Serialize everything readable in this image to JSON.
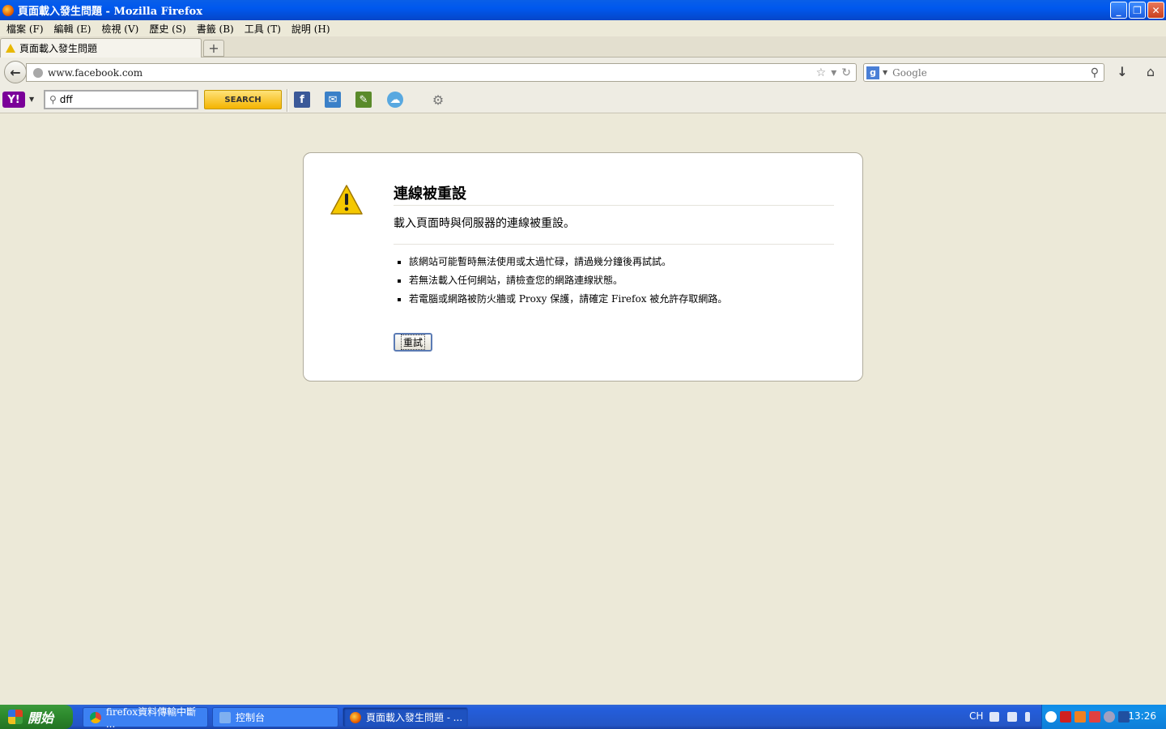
{
  "window": {
    "title": "頁面載入發生問題 - Mozilla Firefox",
    "controls": {
      "minimize": "_",
      "restore": "❐",
      "close": "✕"
    }
  },
  "menu": [
    "檔案 (F)",
    "編輯 (E)",
    "檢視 (V)",
    "歷史 (S)",
    "書籤 (B)",
    "工具 (T)",
    "說明 (H)"
  ],
  "tabs": [
    {
      "label": "頁面載入發生問題",
      "icon": "warning-icon"
    }
  ],
  "new_tab_label": "+",
  "nav": {
    "url": "www.facebook.com",
    "search_placeholder": "Google"
  },
  "yahoo_toolbar": {
    "logo": "Y!",
    "search_value": "dff",
    "search_button": "SEARCH",
    "icons": [
      "facebook-icon",
      "mail-icon",
      "notes-icon",
      "weather-icon",
      "gear-icon"
    ]
  },
  "error": {
    "title": "連線被重設",
    "description": "載入頁面時與伺服器的連線被重設。",
    "items": [
      "該網站可能暫時無法使用或太過忙碌，請過幾分鐘後再試試。",
      "若無法載入任何網站，請檢查您的網路連線狀態。",
      "若電腦或網路被防火牆或 Proxy 保護，請確定 Firefox 被允許存取網路。"
    ],
    "retry_button": "重試"
  },
  "taskbar": {
    "start": "開始",
    "items": [
      {
        "label": "firefox資料傳輸中斷 ...",
        "icon": "chrome-icon",
        "active": false
      },
      {
        "label": "控制台",
        "icon": "control-panel-icon",
        "active": false
      },
      {
        "label": "頁面載入發生問題 - ...",
        "icon": "firefox-icon",
        "active": true
      }
    ],
    "language": "CH",
    "clock": "13:26"
  },
  "colors": {
    "titlebar": "#0058EE",
    "taskbar": "#245EDC",
    "start_button": "#2E8B2E",
    "background": "#ECE9D8",
    "warning": "#E8B800"
  }
}
